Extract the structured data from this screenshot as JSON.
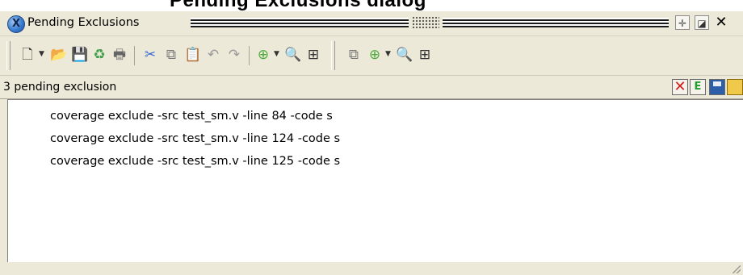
{
  "top_strip": {
    "text": "Pending Exclusions dialog"
  },
  "window": {
    "title": "Pending Exclusions"
  },
  "titlebar_buttons": {
    "pin": "✛",
    "dock": "◪",
    "close": "✕"
  },
  "toolbar": {
    "icons": {
      "new": "🗋",
      "open": "📂",
      "save": "💾",
      "refresh": "♻",
      "print": "🖶",
      "cut": "✂",
      "copy": "⧉",
      "paste": "📋",
      "undo": "↶",
      "redo": "↷",
      "add": "⊕",
      "find": "🔍",
      "tree": "⊞"
    }
  },
  "status": {
    "text": "3 pending exclusion"
  },
  "exclusions": [
    "coverage exclude -src test_sm.v -line 84 -code s",
    "coverage exclude -src test_sm.v -line 124 -code s",
    "coverage exclude -src test_sm.v -line 125 -code s"
  ],
  "colors": {
    "chrome": "#ece9d8",
    "cancel_red": "#d21c1c",
    "exclude_green": "#1fa02e",
    "save_blue": "#2c5fa8",
    "open_yellow": "#f0c84a"
  }
}
